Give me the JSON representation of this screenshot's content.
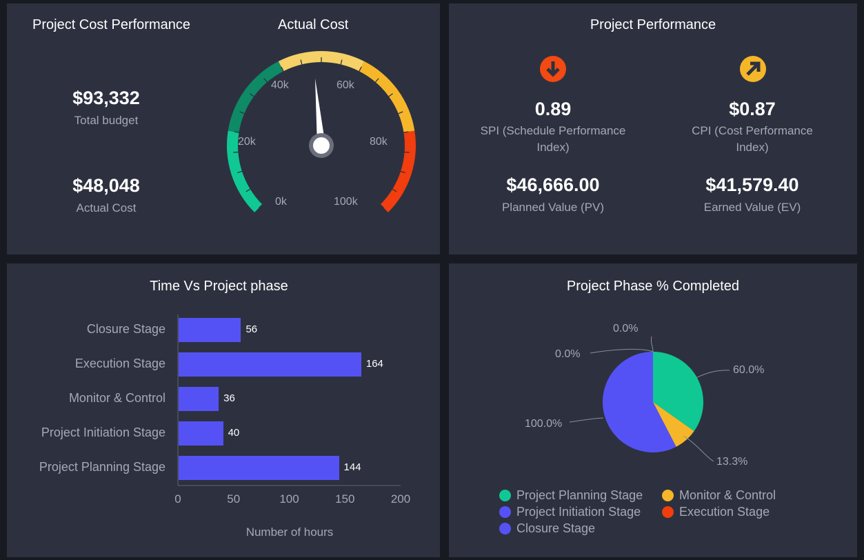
{
  "cost_panel": {
    "title": "Project Cost Performance",
    "total_budget_value": "$93,332",
    "total_budget_label": "Total budget",
    "actual_cost_value": "$48,048",
    "actual_cost_label": "Actual Cost"
  },
  "gauge": {
    "title": "Actual Cost",
    "ticks": [
      "0k",
      "20k",
      "40k",
      "60k",
      "80k",
      "100k"
    ],
    "value": 48048,
    "min": 0,
    "max": 100000,
    "colors": {
      "green_light": "#10c893",
      "green_dark": "#0e8a66",
      "yellow_light": "#f5d168",
      "yellow": "#f5b729",
      "red": "#f23d0e"
    }
  },
  "performance_panel": {
    "title": "Project Performance",
    "spi_icon": "arrow-down-circle-icon",
    "cpi_icon": "arrow-up-right-circle-icon",
    "spi_value": "0.89",
    "spi_label": "SPI (Schedule Performance Index)",
    "cpi_value": "$0.87",
    "cpi_label": "CPI (Cost Performance Index)",
    "pv_value": "$46,666.00",
    "pv_label": "Planned Value (PV)",
    "ev_value": "$41,579.40",
    "ev_label": "Earned Value (EV)",
    "spi_color": "#f24a12",
    "cpi_color": "#f5b729"
  },
  "bar_panel": {
    "title": "Time Vs Project phase",
    "xlabel": "Number of hours"
  },
  "pie_panel": {
    "title": "Project Phase % Completed",
    "legend": [
      {
        "label": "Project Planning Stage",
        "color": "#10c893"
      },
      {
        "label": "Monitor & Control",
        "color": "#f5b729"
      },
      {
        "label": "Project Initiation Stage",
        "color": "#5552f5"
      },
      {
        "label": "Execution Stage",
        "color": "#f23d0e"
      },
      {
        "label": "Closure Stage",
        "color": "#5552f5"
      }
    ]
  },
  "chart_data": [
    {
      "type": "bar",
      "orientation": "horizontal",
      "title": "Time Vs Project phase",
      "xlabel": "Number of hours",
      "categories": [
        "Closure Stage",
        "Execution Stage",
        "Monitor & Control",
        "Project Initiation Stage",
        "Project Planning Stage"
      ],
      "values": [
        56,
        164,
        36,
        40,
        144
      ],
      "xticks": [
        "0",
        "50",
        "100",
        "150",
        "200"
      ],
      "xlim": [
        0,
        200
      ],
      "color": "#5552f5"
    },
    {
      "type": "pie",
      "title": "Project Phase % Completed",
      "slices": [
        {
          "label": "Project Planning Stage",
          "display": "60.0%",
          "value": 0.32,
          "color": "#10c893"
        },
        {
          "label": "Monitor & Control",
          "display": "13.3%",
          "value": 0.07,
          "color": "#f5b729"
        },
        {
          "label": "Project Initiation Stage",
          "display": "100.0%",
          "value": 0.53,
          "color": "#5552f5"
        },
        {
          "label": "Execution Stage",
          "display": "0.0%",
          "value": 0,
          "color": "#f23d0e"
        },
        {
          "label": "Closure Stage",
          "display": "0.0%",
          "value": 0,
          "color": "#5552f5"
        }
      ]
    }
  ]
}
